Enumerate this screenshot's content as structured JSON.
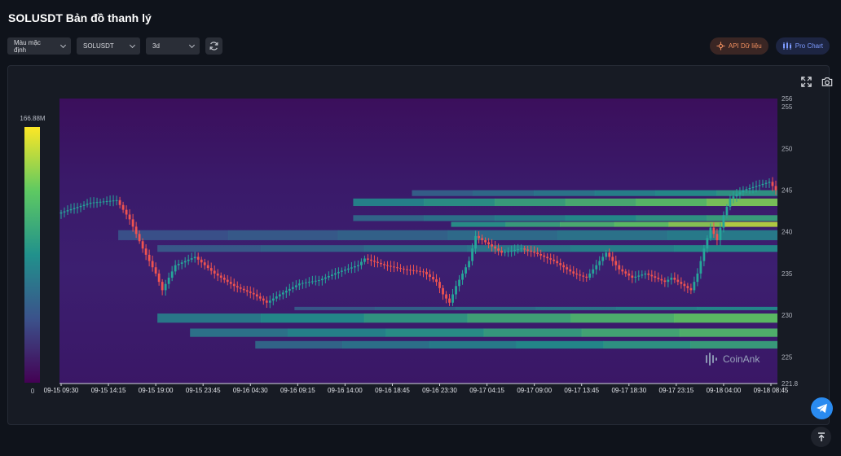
{
  "page": {
    "title": "SOLUSDT Bản đồ thanh lý"
  },
  "toolbar": {
    "color_select": "Màu mặc định",
    "symbol_select": "SOLUSDT",
    "range_select": "3d"
  },
  "actions": {
    "api_label": "API Dữ liệu",
    "pro_label": "Pro Chart"
  },
  "colors": {
    "api": "#f08f5f",
    "pro": "#7d9bff",
    "up": "#26a69a",
    "down": "#ef5350",
    "bg": "#171b24"
  },
  "chart_data": {
    "type": "heatmap",
    "watermark": "CoinAnk",
    "colorbar": {
      "max_label": "166.88M",
      "min_label": "0"
    },
    "y_axis": {
      "min": 221.8,
      "max": 256,
      "ticks": [
        "256",
        "255",
        "250",
        "245",
        "240",
        "235",
        "230",
        "225",
        "221.8"
      ]
    },
    "x_axis": {
      "ticks": [
        "09-15 09:30",
        "09-15 14:15",
        "09-15 19:00",
        "09-15 23:45",
        "09-16 04:30",
        "09-16 09:15",
        "09-16 14:00",
        "09-16 18:45",
        "09-16 23:30",
        "09-17 04:15",
        "09-17 09:00",
        "09-17 13:45",
        "09-17 18:30",
        "09-17 23:15",
        "09-18 04:00",
        "09-18 08:45"
      ]
    },
    "price_path": [
      [
        0,
        242.2
      ],
      [
        5,
        243.5
      ],
      [
        9,
        243.8
      ],
      [
        11,
        241.5
      ],
      [
        13,
        238.0
      ],
      [
        15,
        235.0
      ],
      [
        16,
        233.0
      ],
      [
        18,
        236.0
      ],
      [
        21,
        237.0
      ],
      [
        24,
        235.0
      ],
      [
        27,
        233.5
      ],
      [
        30,
        232.5
      ],
      [
        32,
        231.5
      ],
      [
        34,
        232.5
      ],
      [
        37,
        233.8
      ],
      [
        40,
        234.2
      ],
      [
        43,
        235.2
      ],
      [
        46,
        236.0
      ],
      [
        47,
        236.8
      ],
      [
        50,
        236.0
      ],
      [
        53,
        235.5
      ],
      [
        56,
        235.2
      ],
      [
        58,
        234.0
      ],
      [
        59,
        232.5
      ],
      [
        60,
        231.5
      ],
      [
        61,
        233.5
      ],
      [
        63,
        236.5
      ],
      [
        64,
        239.5
      ],
      [
        66,
        238.5
      ],
      [
        68,
        237.5
      ],
      [
        71,
        238.0
      ],
      [
        73,
        237.5
      ],
      [
        76,
        236.5
      ],
      [
        79,
        235.0
      ],
      [
        81,
        234.5
      ],
      [
        82,
        235.5
      ],
      [
        83,
        236.5
      ],
      [
        84,
        237.5
      ],
      [
        86,
        235.5
      ],
      [
        88,
        234.5
      ],
      [
        90,
        235.0
      ],
      [
        93,
        234.0
      ],
      [
        94,
        234.5
      ],
      [
        96,
        233.5
      ],
      [
        97,
        233.0
      ],
      [
        98,
        235.0
      ],
      [
        99,
        238.0
      ],
      [
        100,
        240.5
      ],
      [
        101,
        239.0
      ],
      [
        102,
        242.0
      ],
      [
        103,
        244.0
      ],
      [
        105,
        245.0
      ],
      [
        107,
        245.5
      ],
      [
        109,
        246.0
      ],
      [
        110,
        245.0
      ]
    ],
    "liquidation_bands": [
      {
        "from": 244.3,
        "to": 245.0,
        "start": 54,
        "end": 110,
        "intensity": 0.55
      },
      {
        "from": 243.1,
        "to": 244.0,
        "start": 45,
        "end": 110,
        "intensity": 0.8
      },
      {
        "from": 241.3,
        "to": 242.0,
        "start": 45,
        "end": 110,
        "intensity": 0.6
      },
      {
        "from": 240.6,
        "to": 241.2,
        "start": 60,
        "end": 110,
        "intensity": 0.9
      },
      {
        "from": 239.0,
        "to": 240.2,
        "start": 9,
        "end": 110,
        "intensity": 0.45
      },
      {
        "from": 237.6,
        "to": 238.4,
        "start": 15,
        "end": 110,
        "intensity": 0.5
      },
      {
        "from": 230.6,
        "to": 231.0,
        "start": 36,
        "end": 110,
        "intensity": 0.5
      },
      {
        "from": 229.1,
        "to": 230.2,
        "start": 15,
        "end": 110,
        "intensity": 0.75
      },
      {
        "from": 227.4,
        "to": 228.4,
        "start": 20,
        "end": 110,
        "intensity": 0.7
      },
      {
        "from": 226.0,
        "to": 226.9,
        "start": 30,
        "end": 110,
        "intensity": 0.6
      }
    ]
  }
}
